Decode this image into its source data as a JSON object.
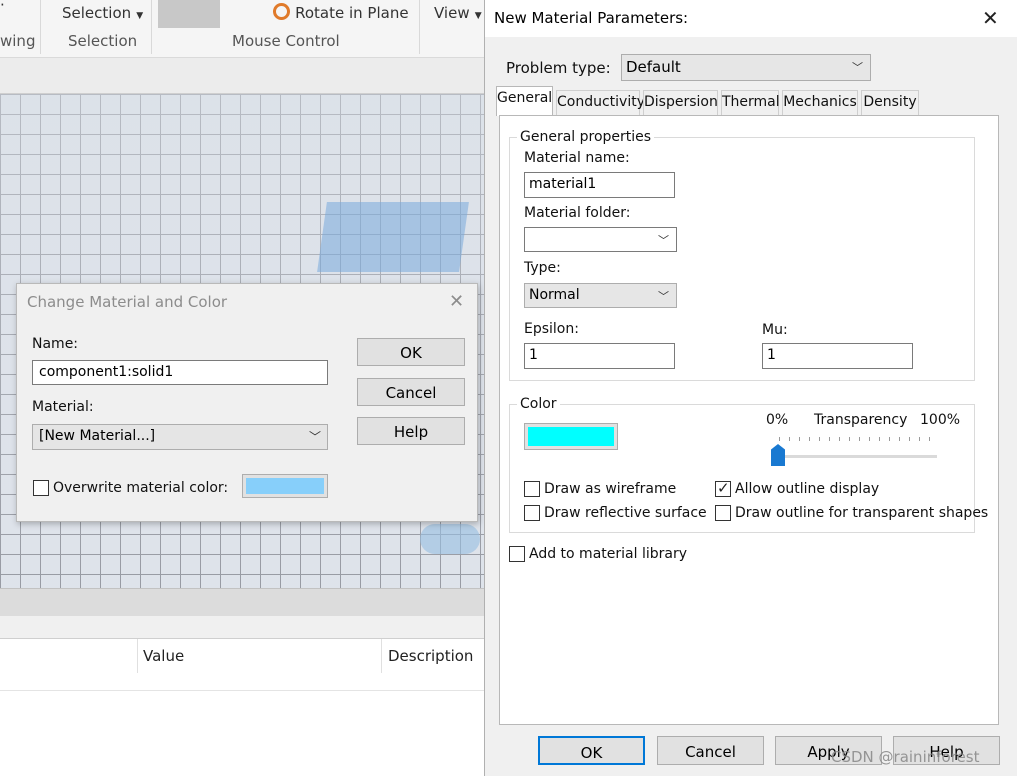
{
  "ribbon": {
    "partial_left_label": "wing",
    "selection_label": "Selection",
    "selection_group": "Selection",
    "rotate_label": "Rotate in Plane",
    "mouse_group": "Mouse Control",
    "view_label": "View"
  },
  "properties": {
    "col_value": "Value",
    "col_description": "Description"
  },
  "change_material_dialog": {
    "title": "Change Material and Color",
    "name_label": "Name:",
    "name_value": "component1:solid1",
    "material_label": "Material:",
    "material_value": "[New Material...]",
    "overwrite_label": "Overwrite material color:",
    "overwrite_checked": false,
    "swatch_color": "#87cffa",
    "ok": "OK",
    "cancel": "Cancel",
    "help": "Help"
  },
  "new_material_dialog": {
    "title": "New Material Parameters:",
    "problem_type_label": "Problem type:",
    "problem_type_value": "Default",
    "tabs": [
      "General",
      "Conductivity",
      "Dispersion",
      "Thermal",
      "Mechanics",
      "Density"
    ],
    "active_tab": "General",
    "general": {
      "group_title": "General properties",
      "material_name_label": "Material name:",
      "material_name_value": "material1",
      "material_folder_label": "Material folder:",
      "material_folder_value": "",
      "type_label": "Type:",
      "type_value": "Normal",
      "epsilon_label": "Epsilon:",
      "epsilon_value": "1",
      "mu_label": "Mu:",
      "mu_value": "1"
    },
    "color": {
      "group_title": "Color",
      "swatch_color": "#00ffff",
      "transparency_label": "Transparency",
      "min_label": "0%",
      "max_label": "100%",
      "transparency_value": 0,
      "draw_wireframe": "Draw as wireframe",
      "draw_wireframe_checked": false,
      "draw_reflective": "Draw reflective surface",
      "draw_reflective_checked": false,
      "allow_outline": "Allow outline display",
      "allow_outline_checked": true,
      "draw_outline_transparent": "Draw outline for transparent shapes",
      "draw_outline_transparent_checked": false
    },
    "add_to_library": "Add to material library",
    "add_to_library_checked": false,
    "buttons": {
      "ok": "OK",
      "cancel": "Cancel",
      "apply": "Apply",
      "help": "Help"
    }
  },
  "watermark": "CSDN @raininforest"
}
